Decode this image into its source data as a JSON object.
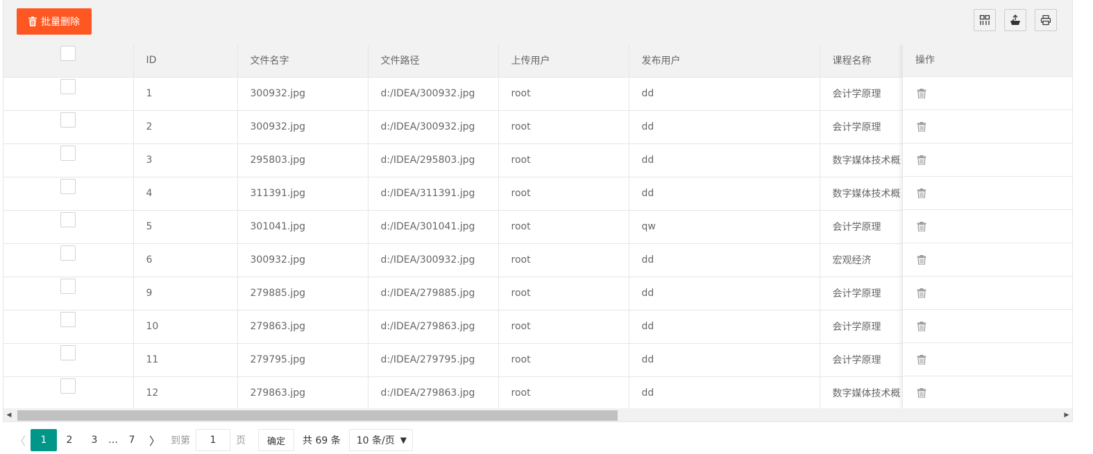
{
  "toolbar": {
    "batch_delete_label": "批量删除",
    "icons": [
      "columns-filter-icon",
      "export-icon",
      "print-icon"
    ]
  },
  "table": {
    "columns": [
      "",
      "ID",
      "文件名字",
      "文件路径",
      "上传用户",
      "发布用户",
      "课程名称"
    ],
    "action_header": "操作",
    "rows": [
      {
        "id": "1",
        "file_name": "300932.jpg",
        "file_path": "d:/IDEA/300932.jpg",
        "uploader": "root",
        "publisher": "dd",
        "course": "会计学原理"
      },
      {
        "id": "2",
        "file_name": "300932.jpg",
        "file_path": "d:/IDEA/300932.jpg",
        "uploader": "root",
        "publisher": "dd",
        "course": "会计学原理"
      },
      {
        "id": "3",
        "file_name": "295803.jpg",
        "file_path": "d:/IDEA/295803.jpg",
        "uploader": "root",
        "publisher": "dd",
        "course": "数字媒体技术概"
      },
      {
        "id": "4",
        "file_name": "311391.jpg",
        "file_path": "d:/IDEA/311391.jpg",
        "uploader": "root",
        "publisher": "dd",
        "course": "数字媒体技术概"
      },
      {
        "id": "5",
        "file_name": "301041.jpg",
        "file_path": "d:/IDEA/301041.jpg",
        "uploader": "root",
        "publisher": "qw",
        "course": "会计学原理"
      },
      {
        "id": "6",
        "file_name": "300932.jpg",
        "file_path": "d:/IDEA/300932.jpg",
        "uploader": "root",
        "publisher": "dd",
        "course": "宏观经济"
      },
      {
        "id": "9",
        "file_name": "279885.jpg",
        "file_path": "d:/IDEA/279885.jpg",
        "uploader": "root",
        "publisher": "dd",
        "course": "会计学原理"
      },
      {
        "id": "10",
        "file_name": "279863.jpg",
        "file_path": "d:/IDEA/279863.jpg",
        "uploader": "root",
        "publisher": "dd",
        "course": "会计学原理"
      },
      {
        "id": "11",
        "file_name": "279795.jpg",
        "file_path": "d:/IDEA/279795.jpg",
        "uploader": "root",
        "publisher": "dd",
        "course": "会计学原理"
      },
      {
        "id": "12",
        "file_name": "279863.jpg",
        "file_path": "d:/IDEA/279863.jpg",
        "uploader": "root",
        "publisher": "dd",
        "course": "数字媒体技术概"
      }
    ]
  },
  "pager": {
    "pages": [
      "1",
      "2",
      "3"
    ],
    "ellipsis": "…",
    "last_page": "7",
    "active_page": "1",
    "goto_label": "到第",
    "goto_value": "1",
    "page_unit": "页",
    "confirm_label": "确定",
    "total_label": "共 69 条",
    "limit_label": "10 条/页"
  },
  "colors": {
    "danger": "#ff5722",
    "active_page": "#009688",
    "header_bg": "#f2f2f2",
    "border": "#e6e6e6"
  }
}
